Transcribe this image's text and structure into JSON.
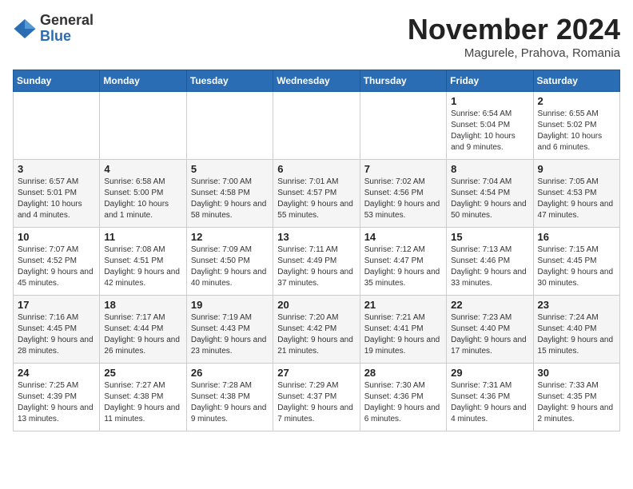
{
  "logo": {
    "general": "General",
    "blue": "Blue"
  },
  "title": "November 2024",
  "subtitle": "Magurele, Prahova, Romania",
  "days_of_week": [
    "Sunday",
    "Monday",
    "Tuesday",
    "Wednesday",
    "Thursday",
    "Friday",
    "Saturday"
  ],
  "weeks": [
    [
      {
        "day": "",
        "info": ""
      },
      {
        "day": "",
        "info": ""
      },
      {
        "day": "",
        "info": ""
      },
      {
        "day": "",
        "info": ""
      },
      {
        "day": "",
        "info": ""
      },
      {
        "day": "1",
        "info": "Sunrise: 6:54 AM\nSunset: 5:04 PM\nDaylight: 10 hours and 9 minutes."
      },
      {
        "day": "2",
        "info": "Sunrise: 6:55 AM\nSunset: 5:02 PM\nDaylight: 10 hours and 6 minutes."
      }
    ],
    [
      {
        "day": "3",
        "info": "Sunrise: 6:57 AM\nSunset: 5:01 PM\nDaylight: 10 hours and 4 minutes."
      },
      {
        "day": "4",
        "info": "Sunrise: 6:58 AM\nSunset: 5:00 PM\nDaylight: 10 hours and 1 minute."
      },
      {
        "day": "5",
        "info": "Sunrise: 7:00 AM\nSunset: 4:58 PM\nDaylight: 9 hours and 58 minutes."
      },
      {
        "day": "6",
        "info": "Sunrise: 7:01 AM\nSunset: 4:57 PM\nDaylight: 9 hours and 55 minutes."
      },
      {
        "day": "7",
        "info": "Sunrise: 7:02 AM\nSunset: 4:56 PM\nDaylight: 9 hours and 53 minutes."
      },
      {
        "day": "8",
        "info": "Sunrise: 7:04 AM\nSunset: 4:54 PM\nDaylight: 9 hours and 50 minutes."
      },
      {
        "day": "9",
        "info": "Sunrise: 7:05 AM\nSunset: 4:53 PM\nDaylight: 9 hours and 47 minutes."
      }
    ],
    [
      {
        "day": "10",
        "info": "Sunrise: 7:07 AM\nSunset: 4:52 PM\nDaylight: 9 hours and 45 minutes."
      },
      {
        "day": "11",
        "info": "Sunrise: 7:08 AM\nSunset: 4:51 PM\nDaylight: 9 hours and 42 minutes."
      },
      {
        "day": "12",
        "info": "Sunrise: 7:09 AM\nSunset: 4:50 PM\nDaylight: 9 hours and 40 minutes."
      },
      {
        "day": "13",
        "info": "Sunrise: 7:11 AM\nSunset: 4:49 PM\nDaylight: 9 hours and 37 minutes."
      },
      {
        "day": "14",
        "info": "Sunrise: 7:12 AM\nSunset: 4:47 PM\nDaylight: 9 hours and 35 minutes."
      },
      {
        "day": "15",
        "info": "Sunrise: 7:13 AM\nSunset: 4:46 PM\nDaylight: 9 hours and 33 minutes."
      },
      {
        "day": "16",
        "info": "Sunrise: 7:15 AM\nSunset: 4:45 PM\nDaylight: 9 hours and 30 minutes."
      }
    ],
    [
      {
        "day": "17",
        "info": "Sunrise: 7:16 AM\nSunset: 4:45 PM\nDaylight: 9 hours and 28 minutes."
      },
      {
        "day": "18",
        "info": "Sunrise: 7:17 AM\nSunset: 4:44 PM\nDaylight: 9 hours and 26 minutes."
      },
      {
        "day": "19",
        "info": "Sunrise: 7:19 AM\nSunset: 4:43 PM\nDaylight: 9 hours and 23 minutes."
      },
      {
        "day": "20",
        "info": "Sunrise: 7:20 AM\nSunset: 4:42 PM\nDaylight: 9 hours and 21 minutes."
      },
      {
        "day": "21",
        "info": "Sunrise: 7:21 AM\nSunset: 4:41 PM\nDaylight: 9 hours and 19 minutes."
      },
      {
        "day": "22",
        "info": "Sunrise: 7:23 AM\nSunset: 4:40 PM\nDaylight: 9 hours and 17 minutes."
      },
      {
        "day": "23",
        "info": "Sunrise: 7:24 AM\nSunset: 4:40 PM\nDaylight: 9 hours and 15 minutes."
      }
    ],
    [
      {
        "day": "24",
        "info": "Sunrise: 7:25 AM\nSunset: 4:39 PM\nDaylight: 9 hours and 13 minutes."
      },
      {
        "day": "25",
        "info": "Sunrise: 7:27 AM\nSunset: 4:38 PM\nDaylight: 9 hours and 11 minutes."
      },
      {
        "day": "26",
        "info": "Sunrise: 7:28 AM\nSunset: 4:38 PM\nDaylight: 9 hours and 9 minutes."
      },
      {
        "day": "27",
        "info": "Sunrise: 7:29 AM\nSunset: 4:37 PM\nDaylight: 9 hours and 7 minutes."
      },
      {
        "day": "28",
        "info": "Sunrise: 7:30 AM\nSunset: 4:36 PM\nDaylight: 9 hours and 6 minutes."
      },
      {
        "day": "29",
        "info": "Sunrise: 7:31 AM\nSunset: 4:36 PM\nDaylight: 9 hours and 4 minutes."
      },
      {
        "day": "30",
        "info": "Sunrise: 7:33 AM\nSunset: 4:35 PM\nDaylight: 9 hours and 2 minutes."
      }
    ]
  ]
}
